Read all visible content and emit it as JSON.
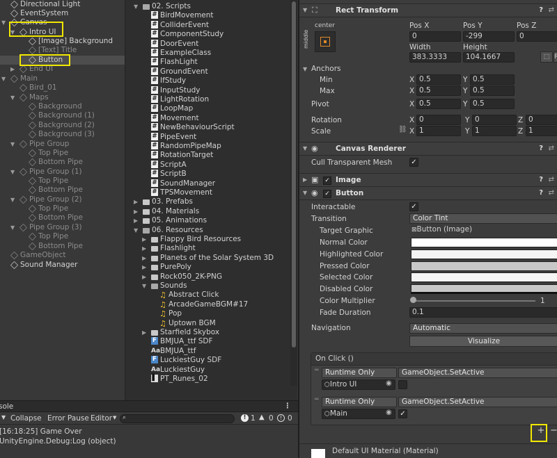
{
  "hierarchy": {
    "items": [
      {
        "label": "Directional Light"
      },
      {
        "label": "EventSystem"
      },
      {
        "label": "Canvas"
      },
      {
        "label": "Intro UI"
      },
      {
        "label": "[Image] Background"
      },
      {
        "label": "[Text] Title"
      },
      {
        "label": "Button"
      },
      {
        "label": "End UI"
      },
      {
        "label": "Main"
      },
      {
        "label": "Bird_01"
      },
      {
        "label": "Maps"
      },
      {
        "label": "Background"
      },
      {
        "label": "Background (1)"
      },
      {
        "label": "Background (2)"
      },
      {
        "label": "Background (3)"
      },
      {
        "label": "Pipe Group"
      },
      {
        "label": "Top Pipe"
      },
      {
        "label": "Bottom Pipe"
      },
      {
        "label": "Pipe Group (1)"
      },
      {
        "label": "Top Pipe"
      },
      {
        "label": "Bottom Pipe"
      },
      {
        "label": "Pipe Group (2)"
      },
      {
        "label": "Top Pipe"
      },
      {
        "label": "Bottom Pipe"
      },
      {
        "label": "Pipe Group (3)"
      },
      {
        "label": "Top Pipe"
      },
      {
        "label": "Bottom Pipe"
      },
      {
        "label": "GameObject"
      },
      {
        "label": "Sound Manager"
      }
    ]
  },
  "project": {
    "items": [
      {
        "label": "02. Scripts",
        "icon": "folder-open-icon"
      },
      {
        "label": "BirdMovement",
        "icon": "script-icon"
      },
      {
        "label": "ColliderEvent",
        "icon": "script-icon"
      },
      {
        "label": "ComponentStudy",
        "icon": "script-icon"
      },
      {
        "label": "DoorEvent",
        "icon": "script-icon"
      },
      {
        "label": "ExampleClass",
        "icon": "script-icon"
      },
      {
        "label": "FlashLight",
        "icon": "script-icon"
      },
      {
        "label": "GroundEvent",
        "icon": "script-icon"
      },
      {
        "label": "IfStudy",
        "icon": "script-icon"
      },
      {
        "label": "InputStudy",
        "icon": "script-icon"
      },
      {
        "label": "LightRotation",
        "icon": "script-icon"
      },
      {
        "label": "LoopMap",
        "icon": "script-icon"
      },
      {
        "label": "Movement",
        "icon": "script-icon"
      },
      {
        "label": "NewBehaviourScript",
        "icon": "script-icon"
      },
      {
        "label": "PipeEvent",
        "icon": "script-icon"
      },
      {
        "label": "RandomPipeMap",
        "icon": "script-icon"
      },
      {
        "label": "RotationTarget",
        "icon": "script-icon"
      },
      {
        "label": "ScriptA",
        "icon": "script-icon"
      },
      {
        "label": "ScriptB",
        "icon": "script-icon"
      },
      {
        "label": "SoundManager",
        "icon": "script-icon"
      },
      {
        "label": "TPSMovement",
        "icon": "script-icon"
      },
      {
        "label": "03. Prefabs",
        "icon": "folder-icon"
      },
      {
        "label": "04. Materials",
        "icon": "folder-icon"
      },
      {
        "label": "05. Animations",
        "icon": "folder-icon"
      },
      {
        "label": "06. Resources",
        "icon": "folder-open-icon"
      },
      {
        "label": "Flappy Bird Resources",
        "icon": "folder-icon"
      },
      {
        "label": "Flashlight",
        "icon": "folder-icon"
      },
      {
        "label": "Planets of the Solar System 3D",
        "icon": "folder-icon"
      },
      {
        "label": "PurePoly",
        "icon": "folder-icon"
      },
      {
        "label": "Rock050_2K-PNG",
        "icon": "folder-icon"
      },
      {
        "label": "Sounds",
        "icon": "folder-open-icon"
      },
      {
        "label": "Abstract Click",
        "icon": "audio-icon"
      },
      {
        "label": "ArcadeGameBGM#17",
        "icon": "audio-icon"
      },
      {
        "label": "Pop",
        "icon": "audio-icon"
      },
      {
        "label": "Uptown BGM",
        "icon": "audio-icon"
      },
      {
        "label": "Starfield Skybox",
        "icon": "folder-icon"
      },
      {
        "label": "BMJUA_ttf SDF",
        "icon": "font-asset-icon"
      },
      {
        "label": "BMJUA_ttf",
        "icon": "font-icon"
      },
      {
        "label": "LuckiestGuy SDF",
        "icon": "font-asset-icon"
      },
      {
        "label": "LuckiestGuy",
        "icon": "font-icon"
      },
      {
        "label": "PT_Runes_02",
        "icon": "texture-icon"
      }
    ]
  },
  "console": {
    "tab": "sole",
    "collapse": "Collapse",
    "error_pause": "Error Pause",
    "editor": "Editor",
    "count_errors": "1",
    "count_warnings": "0",
    "count_logs": "0",
    "log_line1": "[16:18:25] Game Over",
    "log_line2": "UnityEngine.Debug:Log (object)"
  },
  "inspector": {
    "rect": {
      "title": "Rect Transform",
      "anchor_preset": "center",
      "anchor_side": "middle",
      "posx_label": "Pos X",
      "posy_label": "Pos Y",
      "posz_label": "Pos Z",
      "posx": "0",
      "posy": "-299",
      "posz": "0",
      "width_label": "Width",
      "height_label": "Height",
      "width": "383.3333",
      "height": "104.1667",
      "anchors_label": "Anchors",
      "min_label": "Min",
      "max_label": "Max",
      "min_x": "0.5",
      "min_y": "0.5",
      "max_x": "0.5",
      "max_y": "0.5",
      "pivot_label": "Pivot",
      "pivot_x": "0.5",
      "pivot_y": "0.5",
      "rotation_label": "Rotation",
      "rot_x": "0",
      "rot_y": "0",
      "rot_z": "0",
      "scale_label": "Scale",
      "scale_x": "1",
      "scale_y": "1",
      "scale_z": "1",
      "x": "X",
      "y": "Y",
      "z": "Z"
    },
    "canvas_renderer": {
      "title": "Canvas Renderer",
      "cull_label": "Cull Transparent Mesh"
    },
    "image": {
      "title": "Image"
    },
    "button": {
      "title": "Button",
      "interactable_label": "Interactable",
      "transition_label": "Transition",
      "transition_value": "Color Tint",
      "target_graphic_label": "Target Graphic",
      "target_graphic_value": "Button (Image)",
      "normal_color_label": "Normal Color",
      "highlighted_color_label": "Highlighted Color",
      "pressed_color_label": "Pressed Color",
      "selected_color_label": "Selected Color",
      "disabled_color_label": "Disabled Color",
      "color_multiplier_label": "Color Multiplier",
      "color_multiplier_value": "1",
      "fade_duration_label": "Fade Duration",
      "fade_duration_value": "0.1",
      "navigation_label": "Navigation",
      "navigation_value": "Automatic",
      "visualize_label": "Visualize",
      "onclick_label": "On Click ()",
      "events": [
        {
          "mode": "Runtime Only",
          "function": "GameObject.SetActive",
          "target": "Intro UI",
          "checked": false
        },
        {
          "mode": "Runtime Only",
          "function": "GameObject.SetActive",
          "target": "Main",
          "checked": true
        }
      ],
      "add_label": "+",
      "remove_label": "−"
    },
    "material": {
      "label": "Default UI Material (Material)"
    },
    "colors": {
      "normal": "#ffffff",
      "highlighted": "#f5f5f5",
      "pressed": "#c8c8c8",
      "selected": "#f5f5f5",
      "disabled": "#c8c8c8"
    }
  }
}
